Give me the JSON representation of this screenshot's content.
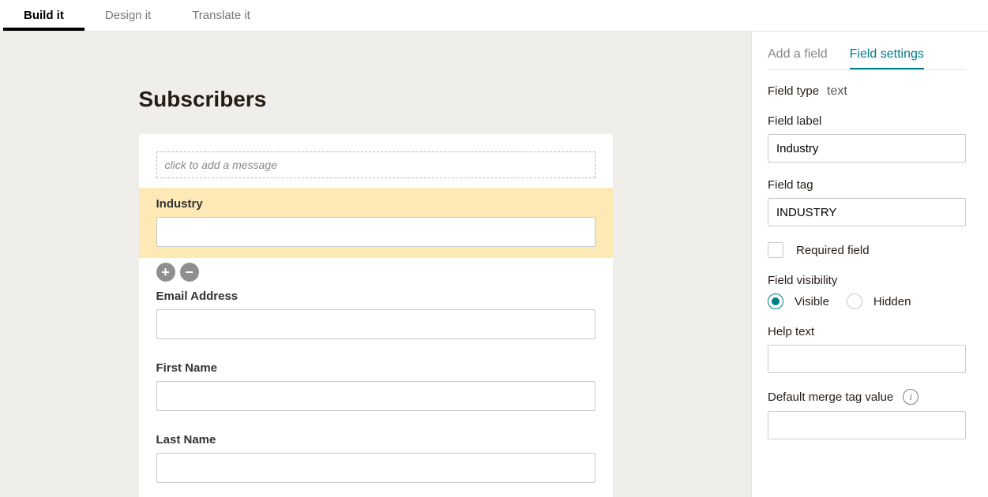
{
  "tabs": {
    "build": "Build it",
    "design": "Design it",
    "translate": "Translate it"
  },
  "canvas": {
    "title": "Subscribers",
    "message_placeholder": "click to add a message",
    "fields": {
      "industry": "Industry",
      "email": "Email Address",
      "first": "First Name",
      "last": "Last Name"
    }
  },
  "panel": {
    "tabs": {
      "add": "Add a field",
      "settings": "Field settings"
    },
    "field_type_label": "Field type",
    "field_type_value": "text",
    "field_label_label": "Field label",
    "field_label_value": "Industry",
    "field_tag_label": "Field tag",
    "field_tag_value": "INDUSTRY",
    "required_label": "Required field",
    "visibility_label": "Field visibility",
    "visible": "Visible",
    "hidden": "Hidden",
    "help_text_label": "Help text",
    "help_text_value": "",
    "default_merge_label": "Default merge tag value",
    "default_merge_value": ""
  }
}
